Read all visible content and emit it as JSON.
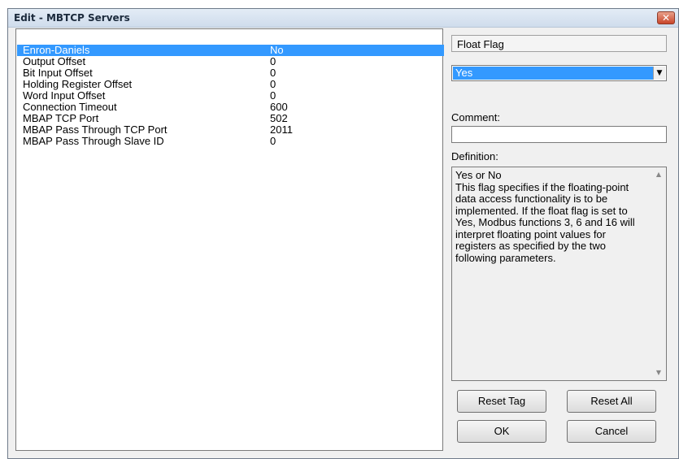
{
  "window": {
    "title": "Edit - MBTCP Servers",
    "close_label": "✕"
  },
  "params": [
    {
      "name": "Enron-Daniels",
      "value": "No",
      "selected": true
    },
    {
      "name": "Output Offset",
      "value": "0"
    },
    {
      "name": "Bit Input Offset",
      "value": "0"
    },
    {
      "name": "Holding Register Offset",
      "value": "0"
    },
    {
      "name": "Word Input Offset",
      "value": "0"
    },
    {
      "name": "Connection Timeout",
      "value": "600"
    },
    {
      "name": "MBAP TCP Port",
      "value": "502"
    },
    {
      "name": "MBAP Pass Through TCP Port",
      "value": "2011"
    },
    {
      "name": "MBAP Pass Through Slave ID",
      "value": "0"
    }
  ],
  "editor": {
    "param_title": "Float Flag",
    "selected_value": "Yes",
    "dropdown_arrow": "▼",
    "comment_label": "Comment:",
    "comment_value": "",
    "definition_label": "Definition:",
    "definition_text": "Yes or No\nThis flag specifies if the floating-point data access functionality is to be implemented. If the float flag is set to Yes, Modbus functions 3, 6 and 16 will interpret floating point values for registers as specified by the two following parameters.",
    "scroll_up": "▲",
    "scroll_down": "▼"
  },
  "buttons": {
    "reset_tag": "Reset Tag",
    "reset_all": "Reset All",
    "ok": "OK",
    "cancel": "Cancel"
  },
  "colors": {
    "selection": "#3399ff",
    "window_bg": "#f0f0f0",
    "close_button": "#c9452a"
  }
}
